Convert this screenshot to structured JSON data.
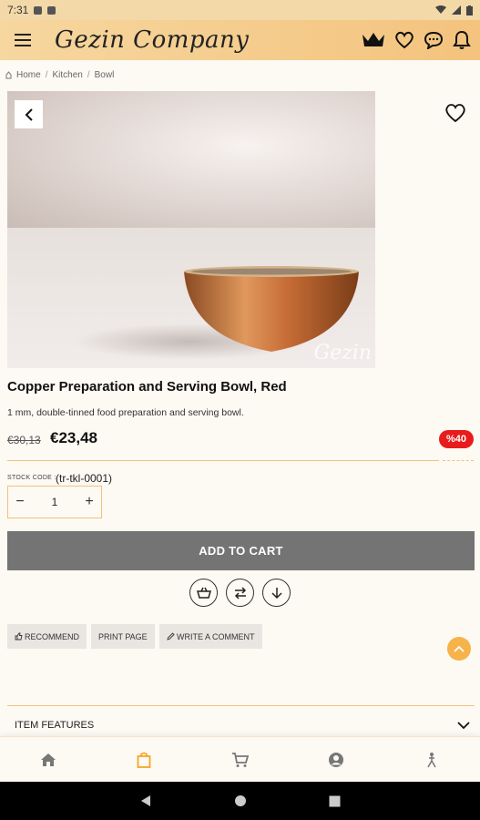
{
  "status_bar": {
    "time": "7:31"
  },
  "app_bar": {
    "logo_text": "Gezin Company"
  },
  "breadcrumb": {
    "items": [
      "Home",
      "Kitchen",
      "Bowl"
    ]
  },
  "product": {
    "watermark": "Gezin",
    "title": "Copper Preparation and Serving Bowl, Red",
    "description": "1 mm, double-tinned food preparation and serving bowl.",
    "old_price": "€30,13",
    "new_price": "€23,48",
    "discount": "%40",
    "stock_code_label": "STOCK CODE :",
    "stock_code_value": "(tr-tkl-0001)",
    "quantity": "1"
  },
  "actions": {
    "qty_minus": "−",
    "qty_plus": "+",
    "add_to_cart": "ADD TO CART",
    "recommend": "RECOMMEND",
    "print_page": "PRINT PAGE",
    "write_comment": "WRITE A COMMENT"
  },
  "sections": {
    "item_features": "ITEM FEATURES"
  },
  "colors": {
    "accent": "#f4c37d",
    "discount": "#e81c1c",
    "cart_button": "#747474",
    "active_nav": "#f5a623"
  },
  "icons": [
    "menu-icon",
    "crown-icon",
    "heart-icon",
    "chat-icon",
    "bell-icon",
    "back-icon",
    "favorite-icon",
    "basket-icon",
    "compare-icon",
    "download-icon",
    "home-icon",
    "bag-icon",
    "cart-icon",
    "account-icon",
    "person-icon"
  ]
}
